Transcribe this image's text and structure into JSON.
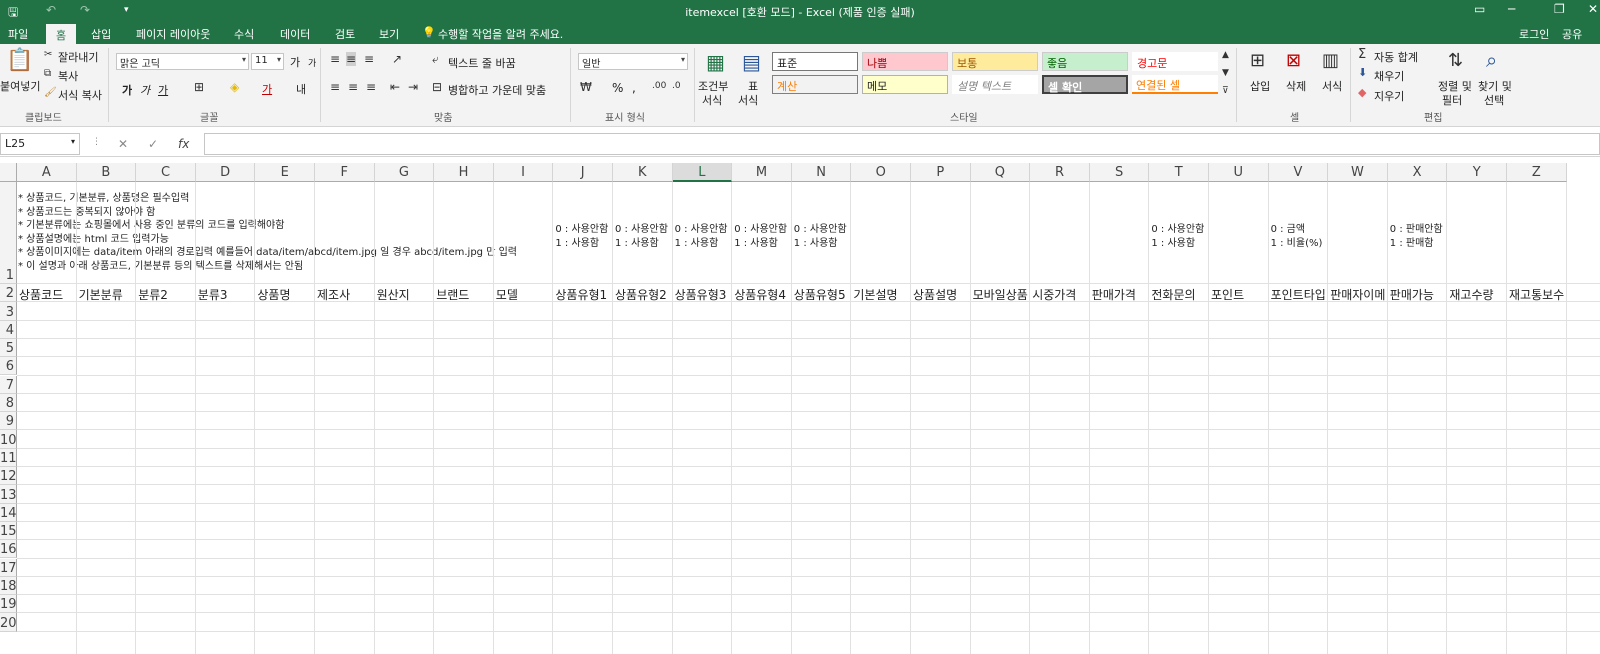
{
  "title": "itemexcel  [호환 모드] - Excel (제품 인증 실패)",
  "quick_access": {
    "save": "🖫",
    "undo": "↶",
    "redo": "↷",
    "customize": "▾"
  },
  "window_buttons": {
    "ribbon_display": "▭",
    "minimize": "─",
    "restore": "❐",
    "close": "✕"
  },
  "tabs": [
    "파일",
    "홈",
    "삽입",
    "페이지 레이아웃",
    "수식",
    "데이터",
    "검토",
    "보기"
  ],
  "active_tab": "홈",
  "tell_me": "수행할 작업을 알려 주세요.",
  "login": "로그인",
  "share": "공유",
  "clipboard": {
    "paste": "붙여넣기",
    "cut": "잘라내기",
    "copy": "복사",
    "format_painter": "서식 복사",
    "label": "클립보드"
  },
  "font": {
    "name": "맑은 고딕",
    "size": "11",
    "label": "글꼴",
    "grow": "가",
    "shrink": "가",
    "bold": "가",
    "italic": "가",
    "underline": "가",
    "font_color_glyph": "가",
    "phonetic": "내"
  },
  "alignment": {
    "wrap": "텍스트 줄 바꿈",
    "merge": "병합하고 가운데 맞춤",
    "label": "맞춤"
  },
  "number": {
    "format": "일반",
    "label": "표시 형식",
    "percent": "%",
    "comma": ","
  },
  "styles": {
    "conditional_1": "조건부",
    "conditional_2": "서식",
    "table_1": "표",
    "table_2": "서식",
    "label": "스타일",
    "items": {
      "normal": "표준",
      "bad": "나쁨",
      "neutral": "보통",
      "good": "좋음",
      "warning": "경고문",
      "calc": "계산",
      "memo": "메모",
      "explain": "설명 텍스트",
      "check": "셀 확인",
      "linked": "연결된 셀"
    },
    "colors": {
      "bad_bg": "#ffc7ce",
      "bad_fg": "#9c0006",
      "neutral_bg": "#ffeb9c",
      "neutral_fg": "#9c5700",
      "good_bg": "#c6efce",
      "good_fg": "#006100",
      "warning_fg": "#ff0000",
      "calc_fg": "#fa7d00",
      "memo_bg": "#ffffcc",
      "check_bg": "#a5a5a5",
      "linked_fg": "#fa7d00"
    }
  },
  "cells": {
    "insert": "삽입",
    "delete": "삭제",
    "format": "서식",
    "label": "셀"
  },
  "editing": {
    "autosum": "자동 합계",
    "fill": "채우기",
    "clear": "지우기",
    "sort_1": "정렬 및",
    "sort_2": "필터",
    "find_1": "찾기 및",
    "find_2": "선택",
    "label": "편집"
  },
  "namebox": "L25",
  "fx_buttons": {
    "cancel": "✕",
    "enter": "✓",
    "fx": "fx"
  },
  "columns": [
    "A",
    "B",
    "C",
    "D",
    "E",
    "F",
    "G",
    "H",
    "I",
    "J",
    "K",
    "L",
    "M",
    "N",
    "O",
    "P",
    "Q",
    "R",
    "S",
    "T",
    "U",
    "V",
    "W",
    "X",
    "Y",
    "Z"
  ],
  "selected_column": "L",
  "rows": [
    "1",
    "2",
    "3",
    "4",
    "5",
    "6",
    "7",
    "8",
    "9",
    "10",
    "11",
    "12",
    "13",
    "14",
    "15",
    "16",
    "17",
    "18",
    "19",
    "20"
  ],
  "row1_notes": [
    "* 상품코드, 기본분류, 상품명은 필수입력",
    "* 상품코드는 중복되지 않아야 함",
    "* 기본분류에는 쇼핑몰에서 사용 중인 분류의 코드를 입력해야함",
    "* 상품설명에는 html 코드 입력가능",
    "* 상품이미지에는 data/item 아래의 경로입력 예를들어 data/item/abcd/item.jpg 일 경우 abcd/item.jpg 만 입력",
    "* 이 설명과 아래 상품코드, 기본분류 등의 텍스트를 삭제해서는 안됨"
  ],
  "row1_col_notes": {
    "J": [
      "0 : 사용안함",
      "1 : 사용함"
    ],
    "K": [
      "0 : 사용안함",
      "1 : 사용함"
    ],
    "L": [
      "0 : 사용안함",
      "1 : 사용함"
    ],
    "M": [
      "0 : 사용안함",
      "1 : 사용함"
    ],
    "N": [
      "0 : 사용안함",
      "1 : 사용함"
    ],
    "T": [
      "0 : 사용안함",
      "1 : 사용함"
    ],
    "V": [
      "0 : 금액",
      "1 : 비율(%)"
    ],
    "X": [
      "0 : 판매안함",
      "1 : 판매함"
    ]
  },
  "row2_headers": [
    "상품코드",
    "기본분류",
    "분류2",
    "분류3",
    "상품명",
    "제조사",
    "원산지",
    "브랜드",
    "모델",
    "상품유형1",
    "상품유형2",
    "상품유형3",
    "상품유형4",
    "상품유형5",
    "기본설명",
    "상품설명",
    "모바일상품",
    "시중가격",
    "판매가격",
    "전화문의",
    "포인트",
    "포인트타입",
    "판매자이메",
    "판매가능",
    "재고수량",
    "재고통보수"
  ]
}
